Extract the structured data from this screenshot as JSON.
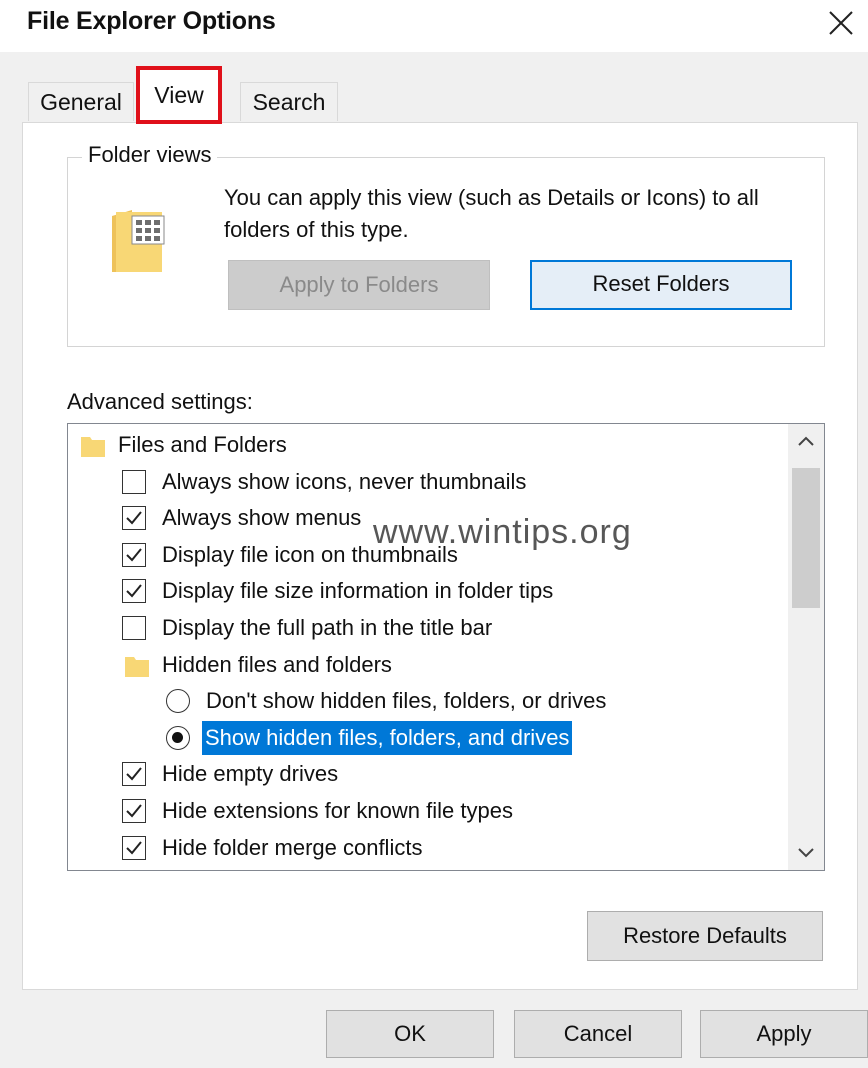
{
  "window": {
    "title": "File Explorer Options",
    "close_icon": "close-icon"
  },
  "tabs": [
    {
      "label": "General",
      "selected": false
    },
    {
      "label": "View",
      "selected": true,
      "highlight_color": "#e0101a"
    },
    {
      "label": "Search",
      "selected": false
    }
  ],
  "folder_views": {
    "legend": "Folder views",
    "description": "You can apply this view (such as Details or Icons) to all folders of this type.",
    "apply_button": {
      "label": "Apply to Folders",
      "enabled": false
    },
    "reset_button": {
      "label": "Reset Folders",
      "focused": true
    }
  },
  "advanced": {
    "label": "Advanced settings:",
    "items": [
      {
        "type": "folder",
        "label": "Files and Folders"
      },
      {
        "type": "checkbox",
        "label": "Always show icons, never thumbnails",
        "checked": false
      },
      {
        "type": "checkbox",
        "label": "Always show menus",
        "checked": true
      },
      {
        "type": "checkbox",
        "label": "Display file icon on thumbnails",
        "checked": true
      },
      {
        "type": "checkbox",
        "label": "Display file size information in folder tips",
        "checked": true
      },
      {
        "type": "checkbox",
        "label": "Display the full path in the title bar",
        "checked": false
      },
      {
        "type": "folder",
        "label": "Hidden files and folders"
      },
      {
        "type": "radio",
        "label": "Don't show hidden files, folders, or drives",
        "checked": false
      },
      {
        "type": "radio",
        "label": "Show hidden files, folders, and drives",
        "checked": true,
        "selected": true
      },
      {
        "type": "checkbox",
        "label": "Hide empty drives",
        "checked": true
      },
      {
        "type": "checkbox",
        "label": "Hide extensions for known file types",
        "checked": true
      },
      {
        "type": "checkbox",
        "label": "Hide folder merge conflicts",
        "checked": true
      }
    ]
  },
  "watermark": "www.wintips.org",
  "buttons": {
    "restore_defaults": "Restore Defaults",
    "ok": "OK",
    "cancel": "Cancel",
    "apply": "Apply"
  },
  "colors": {
    "selection": "#0078d7",
    "folder": "#f8d775",
    "focus_border": "#0078d7"
  }
}
